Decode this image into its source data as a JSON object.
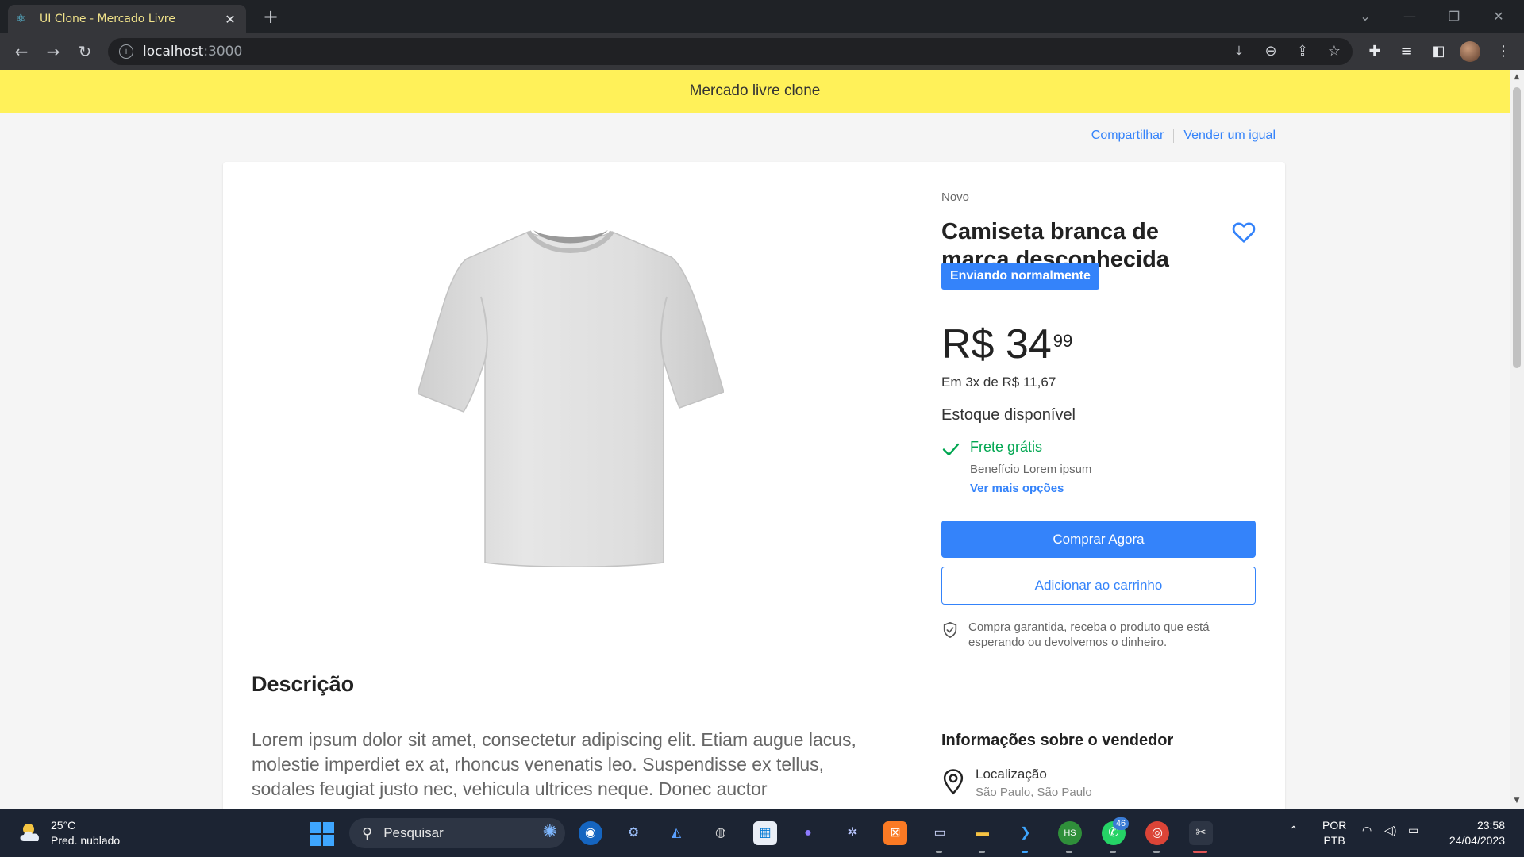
{
  "browser": {
    "tab_title": "UI Clone - Mercado Livre",
    "address": "localhost",
    "address_port": ":3000",
    "new_tab": "+",
    "tab_close": "✕"
  },
  "page": {
    "banner": "Mercado livre clone",
    "links": {
      "share": "Compartilhar",
      "sell": "Vender um igual"
    },
    "product": {
      "condition": "Novo",
      "title": "Camiseta branca de marca desconhecida",
      "badge": "Enviando normalmente",
      "price_main": "R$ 34",
      "price_cents": "99",
      "installments": "Em 3x de R$ 11,67",
      "stock": "Estoque disponível",
      "shipping_title": "Frete grátis",
      "shipping_benefit": "Benefício Lorem ipsum",
      "more_options": "Ver mais opções",
      "buy_now": "Comprar Agora",
      "add_to_cart": "Adicionar ao carrinho",
      "guarantee": "Compra garantida, receba o produto que está esperando ou devolvemos o dinheiro."
    },
    "description": {
      "title": "Descrição",
      "text": "Lorem ipsum dolor sit amet, consectetur adipiscing elit. Etiam augue lacus, molestie imperdiet ex at, rhoncus venenatis leo. Suspendisse ex tellus, sodales feugiat justo nec, vehicula ultrices neque. Donec auctor"
    },
    "seller": {
      "title": "Informações sobre o vendedor",
      "location_label": "Localização",
      "location_value": "São Paulo, São Paulo"
    }
  },
  "taskbar": {
    "temperature": "25°C",
    "weather": "Pred. nublado",
    "search": "Pesquisar",
    "whatsapp_badge": "46",
    "lang_top": "POR",
    "lang_bottom": "PTB",
    "time": "23:58",
    "date": "24/04/2023"
  },
  "colors": {
    "banner": "#fff159",
    "accent": "#3483fa",
    "success": "#00a650"
  }
}
